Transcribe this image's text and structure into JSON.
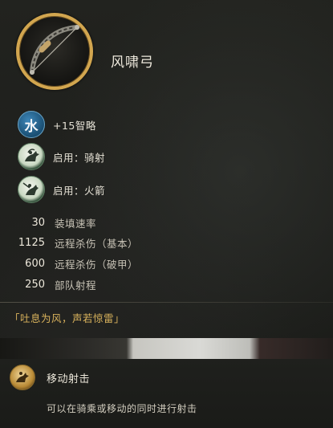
{
  "weapon": {
    "name": "风啸弓",
    "icon": "bow-icon",
    "frame_color": "#d2a64f"
  },
  "abilities": [
    {
      "icon": "water-element-icon",
      "icon_text": "水",
      "label": "+15智略"
    },
    {
      "icon": "horse-archer-skill-icon",
      "label": "启用：骑射"
    },
    {
      "icon": "fire-arrow-skill-icon",
      "label": "启用：火箭"
    }
  ],
  "stats": [
    {
      "value": "30",
      "label": "装填速率"
    },
    {
      "value": "1125",
      "label": "远程杀伤（基本）"
    },
    {
      "value": "600",
      "label": "远程杀伤（破甲）"
    },
    {
      "value": "250",
      "label": "部队射程"
    }
  ],
  "quote": "「吐息为风，声若惊雷」",
  "skill": {
    "icon": "moving-shot-icon",
    "name": "移动射击",
    "description": "可以在骑乘或移动的同时进行射击"
  },
  "colors": {
    "background": "#1d1e1b",
    "quote": "#d9b25c",
    "water": "#2f6d98"
  }
}
